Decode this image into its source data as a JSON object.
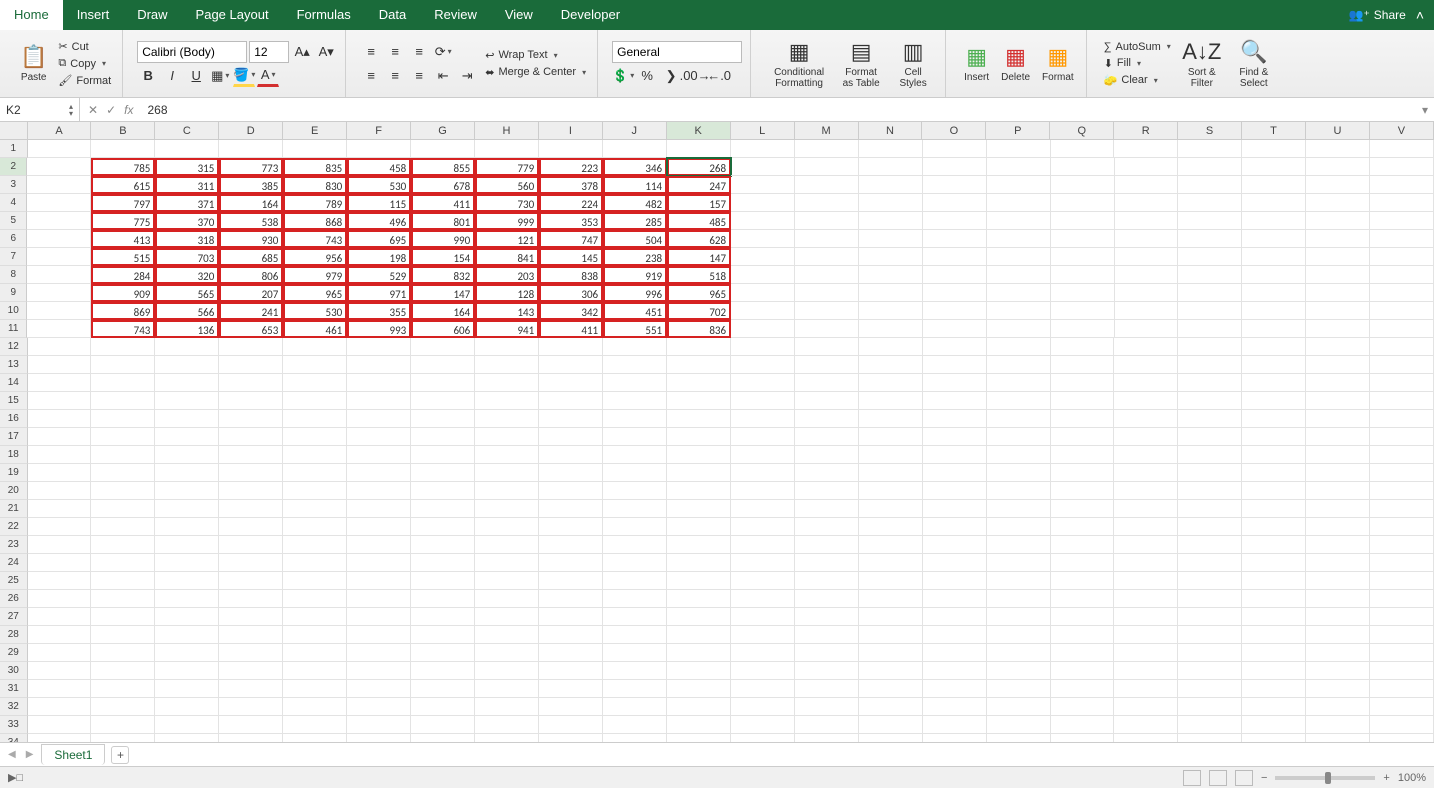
{
  "tabs": [
    "Home",
    "Insert",
    "Draw",
    "Page Layout",
    "Formulas",
    "Data",
    "Review",
    "View",
    "Developer"
  ],
  "active_tab": "Home",
  "share_label": "Share",
  "clipboard": {
    "paste": "Paste",
    "cut": "Cut",
    "copy": "Copy",
    "format": "Format"
  },
  "font": {
    "name": "Calibri (Body)",
    "size": "12"
  },
  "alignment": {
    "wrap": "Wrap Text",
    "merge": "Merge & Center"
  },
  "number": {
    "format": "General"
  },
  "styles": {
    "cond": "Conditional Formatting",
    "table": "Format as Table",
    "cell": "Cell Styles"
  },
  "cells": {
    "insert": "Insert",
    "delete": "Delete",
    "format": "Format"
  },
  "editing": {
    "autosum": "AutoSum",
    "fill": "Fill",
    "clear": "Clear",
    "sort": "Sort & Filter",
    "find": "Find & Select"
  },
  "name_box": "K2",
  "formula_value": "268",
  "columns": [
    "A",
    "B",
    "C",
    "D",
    "E",
    "F",
    "G",
    "H",
    "I",
    "J",
    "K",
    "L",
    "M",
    "N",
    "O",
    "P",
    "Q",
    "R",
    "S",
    "T",
    "U",
    "V"
  ],
  "active_cell": {
    "col": "K",
    "row": 2
  },
  "data_start_row": 2,
  "data_cols": [
    "B",
    "C",
    "D",
    "E",
    "F",
    "G",
    "H",
    "I",
    "J",
    "K"
  ],
  "cells_data": [
    [
      785,
      315,
      773,
      835,
      458,
      855,
      779,
      223,
      346,
      268
    ],
    [
      615,
      311,
      385,
      830,
      530,
      678,
      560,
      378,
      114,
      247
    ],
    [
      797,
      371,
      164,
      789,
      115,
      411,
      730,
      224,
      482,
      157
    ],
    [
      775,
      370,
      538,
      868,
      496,
      801,
      999,
      353,
      285,
      485
    ],
    [
      413,
      318,
      930,
      743,
      695,
      990,
      121,
      747,
      504,
      628
    ],
    [
      515,
      703,
      685,
      956,
      198,
      154,
      841,
      145,
      238,
      147
    ],
    [
      284,
      320,
      806,
      979,
      529,
      832,
      203,
      838,
      919,
      518
    ],
    [
      909,
      565,
      207,
      965,
      971,
      147,
      128,
      306,
      996,
      965
    ],
    [
      869,
      566,
      241,
      530,
      355,
      164,
      143,
      342,
      451,
      702
    ],
    [
      743,
      136,
      653,
      461,
      993,
      606,
      941,
      411,
      551,
      836
    ]
  ],
  "total_rows": 35,
  "sheet_name": "Sheet1",
  "zoom": "100%"
}
